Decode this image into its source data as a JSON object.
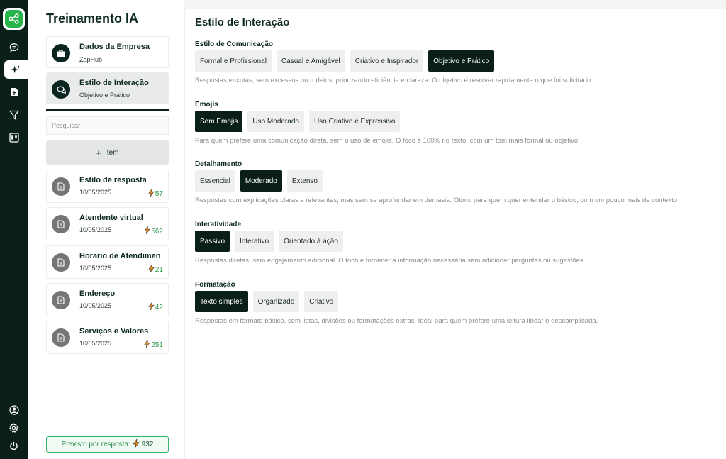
{
  "sidebar_rail": {
    "icons": [
      "logo-icon",
      "chat-icon",
      "sparkle-icon",
      "document-upload-icon",
      "filter-icon",
      "kanban-icon"
    ],
    "bottom_icons": [
      "user-circle-icon",
      "gear-icon",
      "power-icon"
    ],
    "active": "sparkle-icon"
  },
  "panel": {
    "title": "Treinamento IA",
    "company_card": {
      "title": "Dados da Empresa",
      "subtitle": "ZapHub"
    },
    "interaction_card": {
      "title": "Estilo de Interação",
      "subtitle": "Objetivo e Prático"
    },
    "search_placeholder": "Pesquisar",
    "add_label": "Item",
    "items": [
      {
        "title": "Estilo de resposta",
        "date": "10/05/2025",
        "count": "57"
      },
      {
        "title": "Atendente virtual",
        "date": "10/05/2025",
        "count": "562"
      },
      {
        "title": "Horario de Atendimen",
        "date": "10/05/2025",
        "count": "21"
      },
      {
        "title": "Endereço",
        "date": "10/05/2025",
        "count": "42"
      },
      {
        "title": "Serviços e Valores",
        "date": "10/05/2025",
        "count": "251"
      }
    ],
    "footer_label": "Previsto por resposta:",
    "footer_value": "932"
  },
  "main": {
    "title": "Estilo de Interação",
    "sections": [
      {
        "label": "Estilo de Comunicação",
        "options": [
          "Formal e Profissional",
          "Casual e Amigável",
          "Criativo e Inspirador",
          "Objetivo e Prático"
        ],
        "selected": 3,
        "description": "Respostas enxutas, sem excessos ou rodeios, priorizando eficiência e clareza. O objetivo é resolver rapidamente o que foi solicitado."
      },
      {
        "label": "Emojis",
        "options": [
          "Sem Emojis",
          "Uso Moderado",
          "Uso Criativo e Expressivo"
        ],
        "selected": 0,
        "description": "Para quem prefere uma comunicação direta, sem o uso de emojis. O foco é 100% no texto, com um tom mais formal ou objetivo."
      },
      {
        "label": "Detalhamento",
        "options": [
          "Essencial",
          "Moderado",
          "Extenso"
        ],
        "selected": 1,
        "description": "Respostas com explicações claras e relevantes, mas sem se aprofundar em demasia. Ótimo para quem quer entender o básico, com um pouco mais de contexto."
      },
      {
        "label": "Interatividade",
        "options": [
          "Passivo",
          "Interativo",
          "Orientado à ação"
        ],
        "selected": 0,
        "description": "Respostas diretas, sem engajamento adicional. O foco é fornecer a informação necessária sem adicionar perguntas ou sugestões."
      },
      {
        "label": "Formatação",
        "options": [
          "Texto simples",
          "Organizado",
          "Criativo"
        ],
        "selected": 0,
        "description": "Respostas em formato básico, sem listas, divisões ou formatações extras. Ideal para quem prefere uma leitura linear e descomplicada."
      }
    ]
  },
  "colors": {
    "rail": "#0a1f1a",
    "accent_green": "#25b34a",
    "selected_option": "#0b1f1a",
    "count_green": "#2a9a4a"
  }
}
